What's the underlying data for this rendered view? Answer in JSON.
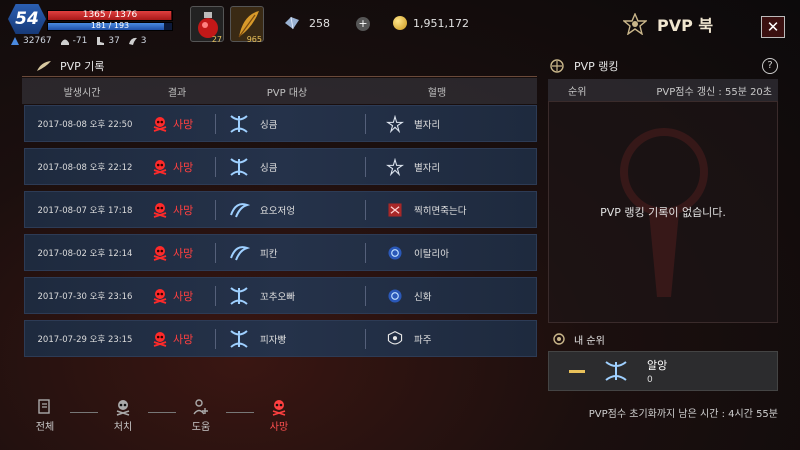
{
  "player": {
    "level": "54",
    "hp": {
      "current": 1365,
      "max": 1376,
      "text": "1365 / 1376"
    },
    "mp": {
      "current": 181,
      "max": 193,
      "text": "181 / 193"
    },
    "stats": [
      {
        "icon": "combat-power-icon",
        "value": "32767"
      },
      {
        "icon": "helmet-icon",
        "value": "-71"
      },
      {
        "icon": "boot-icon",
        "value": "37"
      },
      {
        "icon": "wing-icon",
        "value": "3"
      }
    ]
  },
  "items": {
    "potion": {
      "icon": "red-potion-icon",
      "count": "27"
    },
    "feather": {
      "icon": "feather-icon",
      "count": "965"
    }
  },
  "currency": {
    "crystal": "258",
    "gold": "1,951,172"
  },
  "window": {
    "title": "PVP 북"
  },
  "pvp_log": {
    "section_title": "PVP 기록",
    "columns": [
      "발생시간",
      "결과",
      "PVP 대상",
      "혈맹"
    ],
    "rows": [
      {
        "time": "2017-08-08 오후 22:50",
        "result": "사망",
        "target": "싱큼",
        "class_icon": "bow-class-icon",
        "guild": "별자리",
        "guild_icon": "star-guild-icon"
      },
      {
        "time": "2017-08-08 오후 22:12",
        "result": "사망",
        "target": "싱큼",
        "class_icon": "bow-class-icon",
        "guild": "별자리",
        "guild_icon": "star-guild-icon"
      },
      {
        "time": "2017-08-07 오후 17:18",
        "result": "사망",
        "target": "요오저엉",
        "class_icon": "wind-class-icon",
        "guild": "찍히면죽는다",
        "guild_icon": "red-guild-icon"
      },
      {
        "time": "2017-08-02 오후 12:14",
        "result": "사망",
        "target": "피칸",
        "class_icon": "wind-class-icon",
        "guild": "이탈리아",
        "guild_icon": "blue-guild-icon"
      },
      {
        "time": "2017-07-30 오후 23:16",
        "result": "사망",
        "target": "꼬추오빠",
        "class_icon": "bow-class-icon",
        "guild": "신화",
        "guild_icon": "blue-guild-icon"
      },
      {
        "time": "2017-07-29 오후 23:15",
        "result": "사망",
        "target": "피자빵",
        "class_icon": "bow-class-icon",
        "guild": "파주",
        "guild_icon": "white-guild-icon"
      }
    ]
  },
  "pvp_ranking": {
    "section_title": "PVP 랭킹",
    "rank_label": "순위",
    "update_text": "PVP점수 갱신 : 55분 20초",
    "empty_text": "PVP 랭킹 기록이 없습니다.",
    "my_rank_label": "내 순위",
    "my_rank_value": "—",
    "my_name": "알앙",
    "my_score": "0"
  },
  "tabs": [
    {
      "label": "전체",
      "icon": "all-icon",
      "active": false
    },
    {
      "label": "처치",
      "icon": "skull-crossbones-icon",
      "active": false
    },
    {
      "label": "도움",
      "icon": "assist-icon",
      "active": false
    },
    {
      "label": "사망",
      "icon": "skull-crossbones-icon",
      "active": true
    }
  ],
  "reset_text": "PVP점수 초기화까지 남은 시간 : 4시간 55분",
  "colors": {
    "death_red": "#ff4040",
    "gold": "#e9c15a",
    "row_bg": "#25324a",
    "hp": "#d02a2a",
    "mp": "#2f64c4"
  }
}
